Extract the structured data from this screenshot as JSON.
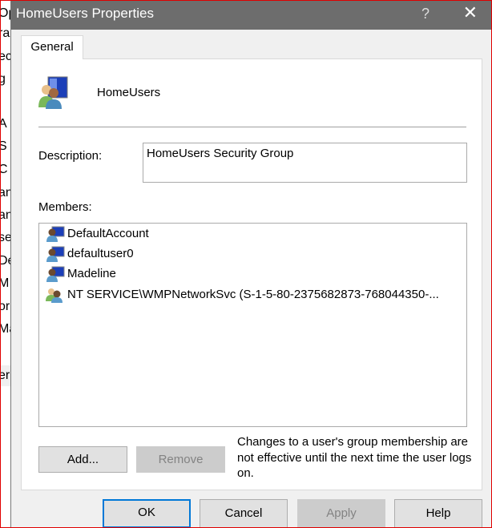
{
  "background_fragments": [
    "Op",
    "rap",
    "ec",
    "g",
    "A",
    "S",
    "C",
    "an",
    "an",
    "se",
    "De",
    "M",
    "or",
    "Ma",
    "er"
  ],
  "title": "HomeUsers Properties",
  "title_help": "?",
  "title_close": "✕",
  "tabs": [
    {
      "label": "General",
      "active": true
    }
  ],
  "group_name": "HomeUsers",
  "description_label": "Description:",
  "description_value": "HomeUsers Security Group",
  "members_label": "Members:",
  "members": [
    {
      "name": "DefaultAccount",
      "icon": "user-icon"
    },
    {
      "name": "defaultuser0",
      "icon": "user-icon"
    },
    {
      "name": "Madeline",
      "icon": "user-icon"
    },
    {
      "name": "NT SERVICE\\WMPNetworkSvc (S-1-5-80-2375682873-768044350-...",
      "icon": "group-icon"
    }
  ],
  "add_label": "Add...",
  "remove_label": "Remove",
  "note": "Changes to a user's group membership are not effective until the next time the user logs on.",
  "buttons": {
    "ok": "OK",
    "cancel": "Cancel",
    "apply": "Apply",
    "help": "Help"
  },
  "colors": {
    "titlebar": "#6d6d6d",
    "default_button_border": "#0078d7",
    "frame": "#e00000"
  }
}
